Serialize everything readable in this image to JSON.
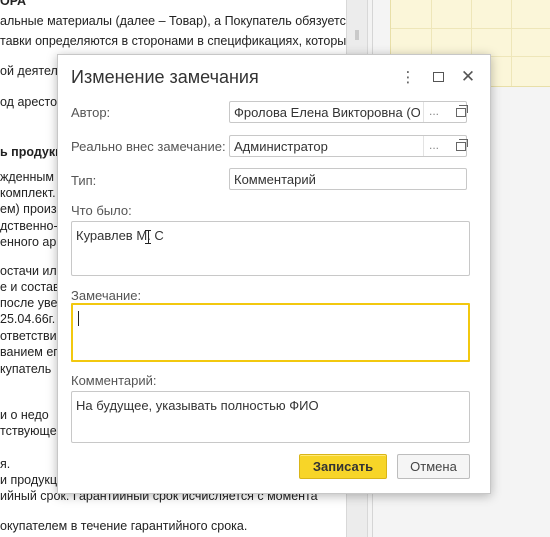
{
  "background_document": {
    "lines": [
      {
        "text": "ОРА",
        "bold": true
      },
      {
        "text": "альные материалы (далее – Товар), а Покупатель обязуется",
        "bold": false
      },
      {
        "text": "тавки определяются в сторонами в спецификациях, которые",
        "bold": false
      },
      {
        "text": "ой деятель",
        "bold": false
      },
      {
        "text": "од арестом",
        "bold": false
      },
      {
        "text": "ь продукц",
        "bold": true
      },
      {
        "text": "жденным",
        "bold": false
      },
      {
        "text": "комплект.",
        "bold": false
      },
      {
        "text": "ем) произв",
        "bold": false
      },
      {
        "text": "дственно-",
        "bold": false
      },
      {
        "text": "енного арб",
        "bold": false
      },
      {
        "text": "остачи или",
        "bold": false
      },
      {
        "text": "е и составл",
        "bold": false
      },
      {
        "text": "после уве",
        "bold": false
      },
      {
        "text": "25.04.66г.",
        "bold": false
      },
      {
        "text": "ответстви",
        "bold": false
      },
      {
        "text": "ванием его",
        "bold": false
      },
      {
        "text": "купатель",
        "bold": false
      },
      {
        "text": "и о недо",
        "bold": false
      },
      {
        "text": "тствующем",
        "bold": false
      },
      {
        "text": "я.",
        "bold": false
      },
      {
        "text": "и продукци",
        "bold": false
      },
      {
        "text": "ийный срок. Гарантийный срок исчисляется с момента",
        "bold": false
      },
      {
        "text": "окупателем в течение гарантийного срока.",
        "bold": false
      }
    ]
  },
  "dialog": {
    "title": "Изменение замечания",
    "author": {
      "label": "Автор:",
      "value": "Фролова Елена Викторовна (От,"
    },
    "actual_author": {
      "label": "Реально внес замечание:",
      "value": "Администратор"
    },
    "type": {
      "label": "Тип:",
      "value": "Комментарий"
    },
    "was": {
      "label": "Что было:",
      "value": "Куравлев М. С"
    },
    "remark": {
      "label": "Замечание:",
      "value": ""
    },
    "comment": {
      "label": "Комментарий:",
      "value": "На будущее, указывать полностью ФИО"
    },
    "select_symbol": "...",
    "buttons": {
      "save": "Записать",
      "cancel": "Отмена"
    }
  },
  "icons": {
    "more": "more-vertical-icon",
    "maximize": "maximize-icon",
    "close": "close-icon",
    "open": "open-form-icon"
  },
  "colors": {
    "accent_yellow": "#f7d528",
    "focus_border": "#f2c80f",
    "dialog_bg": "#ffffff"
  }
}
